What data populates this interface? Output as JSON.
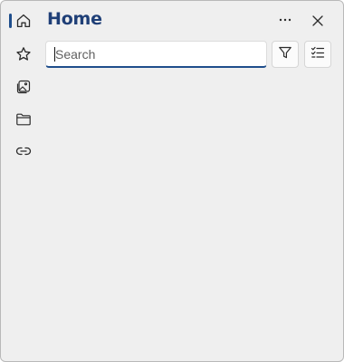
{
  "header": {
    "title": "Home"
  },
  "search": {
    "placeholder": "Search",
    "value": ""
  },
  "nav": {
    "items": [
      {
        "name": "home",
        "icon": "home-icon",
        "selected": true
      },
      {
        "name": "favorites",
        "icon": "star-icon",
        "selected": false
      },
      {
        "name": "images",
        "icon": "image-gallery-icon",
        "selected": false
      },
      {
        "name": "folders",
        "icon": "folder-icon",
        "selected": false
      },
      {
        "name": "links",
        "icon": "link-icon",
        "selected": false
      }
    ]
  },
  "toolbar": {
    "more_icon": "more-horizontal-icon",
    "close_icon": "close-icon",
    "filter_icon": "filter-icon",
    "checklist_icon": "checklist-icon"
  },
  "colors": {
    "accent": "#1f4e8c",
    "title": "#1f3f77",
    "background": "#efefef"
  }
}
